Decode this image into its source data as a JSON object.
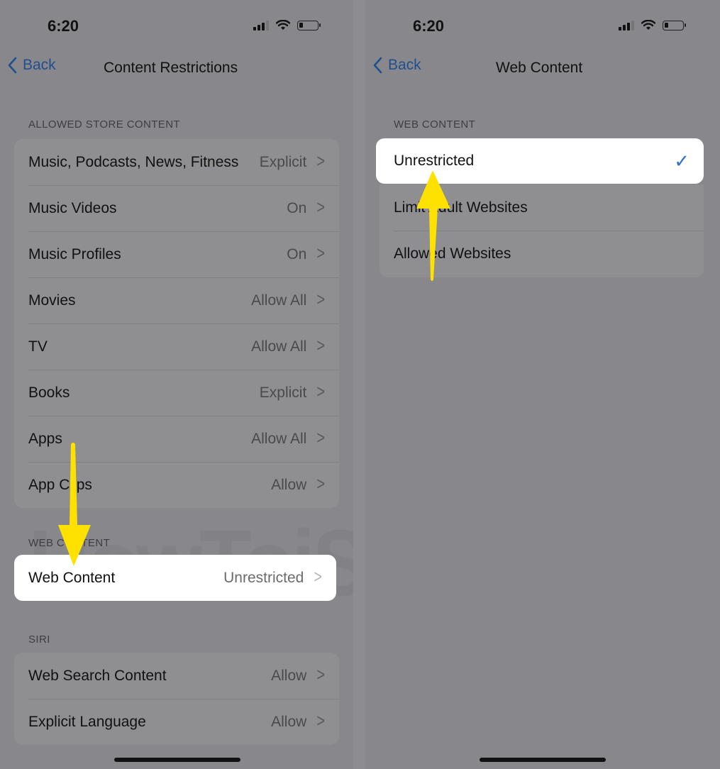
{
  "left_screen": {
    "status_bar": {
      "time": "6:20",
      "icons": [
        "cellular-signal-icon",
        "wifi-icon",
        "battery-icon"
      ]
    },
    "nav": {
      "back_label": "Back",
      "title": "Content Restrictions"
    },
    "sections": [
      {
        "header": "ALLOWED STORE CONTENT",
        "rows": [
          {
            "label": "Music, Podcasts, News, Fitness",
            "value": "Explicit"
          },
          {
            "label": "Music Videos",
            "value": "On"
          },
          {
            "label": "Music Profiles",
            "value": "On"
          },
          {
            "label": "Movies",
            "value": "Allow All"
          },
          {
            "label": "TV",
            "value": "Allow All"
          },
          {
            "label": "Books",
            "value": "Explicit"
          },
          {
            "label": "Apps",
            "value": "Allow All"
          },
          {
            "label": "App Clips",
            "value": "Allow"
          }
        ]
      },
      {
        "header": "WEB CONTENT",
        "rows": [
          {
            "label": "Web Content",
            "value": "Unrestricted",
            "highlighted": true
          }
        ]
      },
      {
        "header": "SIRI",
        "rows": [
          {
            "label": "Web Search Content",
            "value": "Allow"
          },
          {
            "label": "Explicit Language",
            "value": "Allow"
          }
        ]
      }
    ]
  },
  "right_screen": {
    "status_bar": {
      "time": "6:20",
      "icons": [
        "cellular-signal-icon",
        "wifi-icon",
        "battery-icon"
      ]
    },
    "nav": {
      "back_label": "Back",
      "title": "Web Content"
    },
    "section_header": "WEB CONTENT",
    "options": [
      {
        "label": "Unrestricted",
        "selected": true
      },
      {
        "label": "Limit Adult Websites",
        "selected": false
      },
      {
        "label": "Allowed Websites",
        "selected": false
      }
    ]
  },
  "watermark": "HowToiSolve.com",
  "colors": {
    "accent": "#2e6fd1",
    "back_link": "#1f4f8f",
    "arrow": "#ffe100"
  }
}
